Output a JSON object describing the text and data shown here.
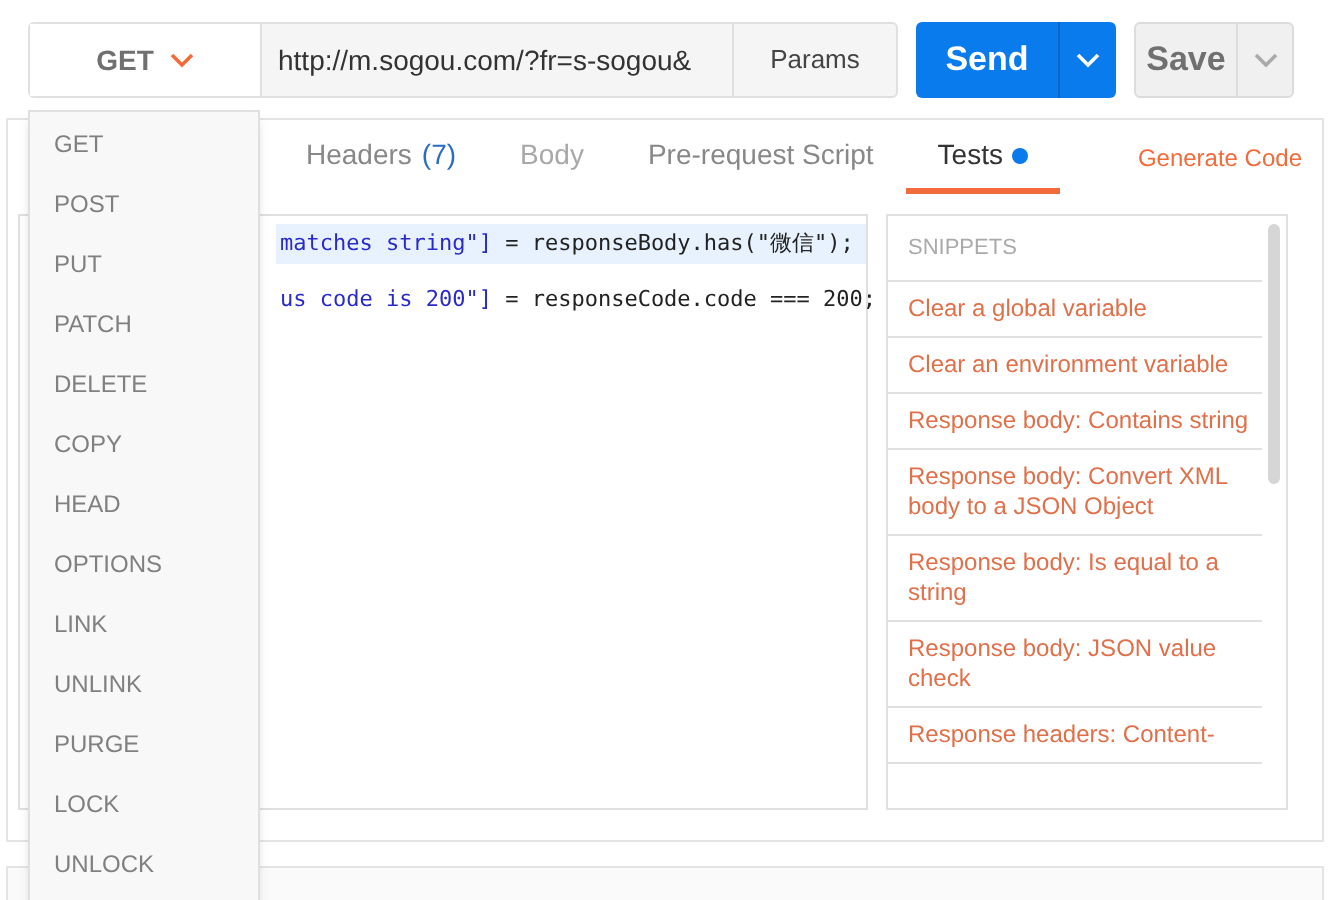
{
  "request": {
    "method": "GET",
    "url": "http://m.sogou.com/?fr=s-sogou&",
    "params_button": "Params",
    "send_button": "Send",
    "save_button": "Save"
  },
  "tabs": [
    {
      "label": "Headers",
      "count": "(7)",
      "selected": false,
      "disabled": false,
      "dot": false
    },
    {
      "label": "Body",
      "selected": false,
      "disabled": true,
      "dot": false
    },
    {
      "label": "Pre-request Script",
      "selected": false,
      "disabled": false,
      "dot": false
    },
    {
      "label": "Tests",
      "selected": true,
      "disabled": false,
      "dot": true
    }
  ],
  "generate_code_link": "Generate Code",
  "editor": {
    "lines": [
      {
        "string_part": "matches string\"]",
        "code_part": " = responseBody.has(\"微信\");",
        "highlighted": true
      },
      {
        "string_part": "us code is 200\"]",
        "code_part": " = responseCode.code === 200;",
        "highlighted": false
      }
    ]
  },
  "snippets": {
    "heading": "SNIPPETS",
    "items": [
      "Clear a global variable",
      "Clear an environment variable",
      "Response body: Contains string",
      "Response body: Convert XML body to a JSON Object",
      "Response body: Is equal to a string",
      "Response body: JSON value check",
      "Response headers: Content-"
    ]
  },
  "method_menu": {
    "items": [
      {
        "label": "GET",
        "selected": false
      },
      {
        "label": "POST",
        "selected": false
      },
      {
        "label": "PUT",
        "selected": false
      },
      {
        "label": "PATCH",
        "selected": false
      },
      {
        "label": "DELETE",
        "selected": false
      },
      {
        "label": "COPY",
        "selected": false
      },
      {
        "label": "HEAD",
        "selected": false
      },
      {
        "label": "OPTIONS",
        "selected": false
      },
      {
        "label": "LINK",
        "selected": false
      },
      {
        "label": "UNLINK",
        "selected": false
      },
      {
        "label": "PURGE",
        "selected": false
      },
      {
        "label": "LOCK",
        "selected": false
      },
      {
        "label": "UNLOCK",
        "selected": false
      }
    ]
  }
}
